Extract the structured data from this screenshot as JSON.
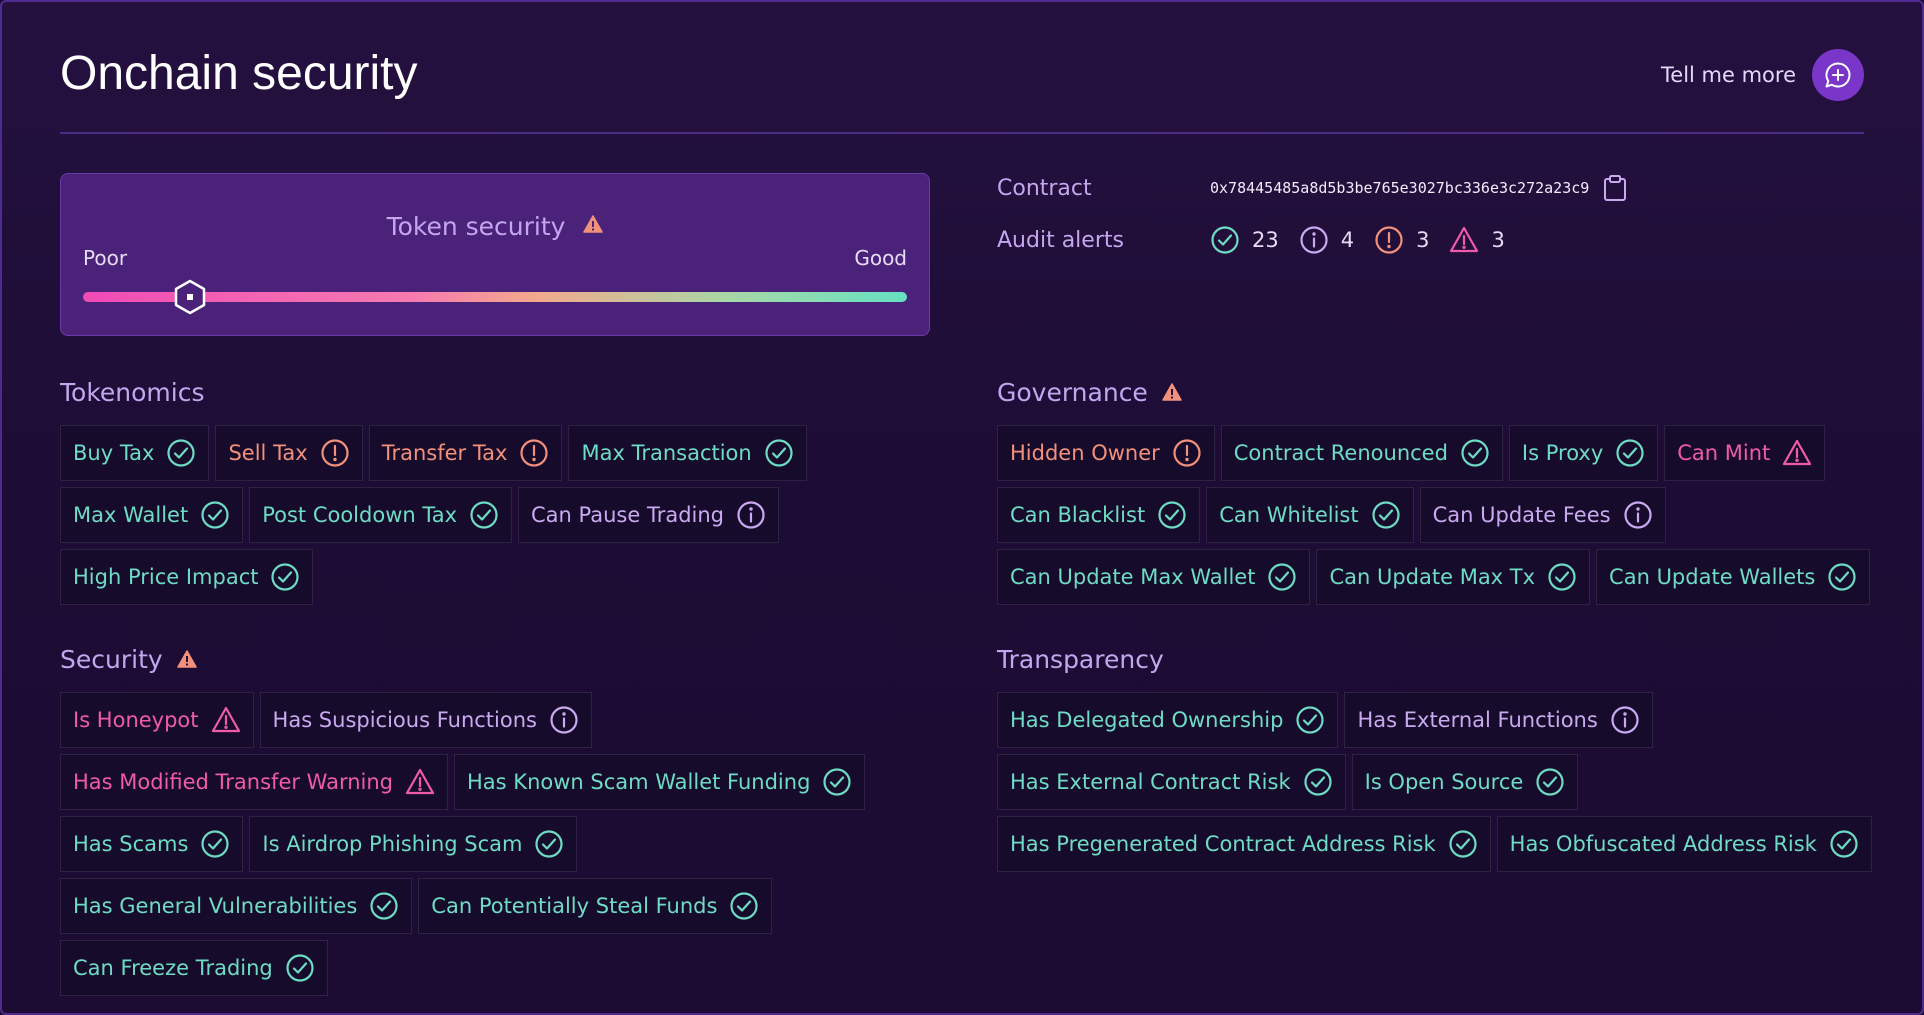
{
  "title": "Onchain security",
  "tell_me_more": "Tell me more",
  "token_security": {
    "title": "Token security",
    "poor_label": "Poor",
    "good_label": "Good",
    "score_fraction": 0.13
  },
  "contract": {
    "label": "Contract",
    "address": "0x78445485a8d5b3be765e3027bc336e3c272a23c9"
  },
  "audit_alerts": {
    "label": "Audit alerts",
    "items": [
      {
        "status": "pass",
        "count": "23"
      },
      {
        "status": "info",
        "count": "4"
      },
      {
        "status": "warning",
        "count": "3"
      },
      {
        "status": "danger",
        "count": "3"
      }
    ]
  },
  "colors": {
    "pass": "#6edcc4",
    "warning": "#f2917b",
    "info": "#c9aaf0",
    "danger": "#ef5ba8"
  },
  "sections": {
    "tokenomics": {
      "title": "Tokenomics",
      "has_alert": false,
      "items": [
        {
          "label": "Buy Tax",
          "status": "pass"
        },
        {
          "label": "Sell Tax",
          "status": "warning"
        },
        {
          "label": "Transfer Tax",
          "status": "warning"
        },
        {
          "label": "Max Transaction",
          "status": "pass"
        },
        {
          "label": "Max Wallet",
          "status": "pass"
        },
        {
          "label": "Post Cooldown Tax",
          "status": "pass"
        },
        {
          "label": "Can Pause Trading",
          "status": "info"
        },
        {
          "label": "High Price Impact",
          "status": "pass"
        }
      ]
    },
    "governance": {
      "title": "Governance",
      "has_alert": true,
      "items": [
        {
          "label": "Hidden Owner",
          "status": "warning"
        },
        {
          "label": "Contract Renounced",
          "status": "pass"
        },
        {
          "label": "Is Proxy",
          "status": "pass"
        },
        {
          "label": "Can Mint",
          "status": "danger"
        },
        {
          "label": "Can Blacklist",
          "status": "pass"
        },
        {
          "label": "Can Whitelist",
          "status": "pass"
        },
        {
          "label": "Can Update Fees",
          "status": "info"
        },
        {
          "label": "Can Update Max Wallet",
          "status": "pass"
        },
        {
          "label": "Can Update Max Tx",
          "status": "pass"
        },
        {
          "label": "Can Update Wallets",
          "status": "pass"
        }
      ]
    },
    "security": {
      "title": "Security",
      "has_alert": true,
      "items": [
        {
          "label": "Is Honeypot",
          "status": "danger"
        },
        {
          "label": "Has Suspicious Functions",
          "status": "info"
        },
        {
          "label": "Has Modified Transfer Warning",
          "status": "danger"
        },
        {
          "label": "Has Known Scam Wallet Funding",
          "status": "pass"
        },
        {
          "label": "Has Scams",
          "status": "pass"
        },
        {
          "label": "Is Airdrop Phishing Scam",
          "status": "pass"
        },
        {
          "label": "Has General Vulnerabilities",
          "status": "pass"
        },
        {
          "label": "Can Potentially Steal Funds",
          "status": "pass"
        },
        {
          "label": "Can Freeze Trading",
          "status": "pass"
        }
      ]
    },
    "transparency": {
      "title": "Transparency",
      "has_alert": false,
      "items": [
        {
          "label": "Has Delegated Ownership",
          "status": "pass"
        },
        {
          "label": "Has External Functions",
          "status": "info"
        },
        {
          "label": "Has External Contract Risk",
          "status": "pass"
        },
        {
          "label": "Is Open Source",
          "status": "pass"
        },
        {
          "label": "Has Pregenerated Contract Address Risk",
          "status": "pass"
        },
        {
          "label": "Has Obfuscated Address Risk",
          "status": "pass"
        }
      ]
    }
  }
}
